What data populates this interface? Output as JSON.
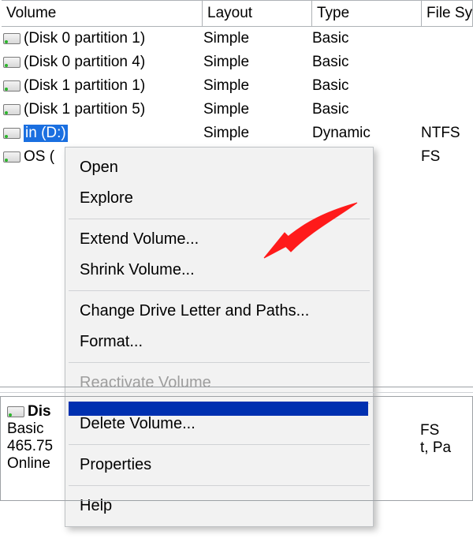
{
  "headers": {
    "volume": "Volume",
    "layout": "Layout",
    "type": "Type",
    "fs": "File Sys"
  },
  "rows": [
    {
      "name": "(Disk 0 partition 1)",
      "layout": "Simple",
      "type": "Basic",
      "fs": ""
    },
    {
      "name": "(Disk 0 partition 4)",
      "layout": "Simple",
      "type": "Basic",
      "fs": ""
    },
    {
      "name": "(Disk 1 partition 1)",
      "layout": "Simple",
      "type": "Basic",
      "fs": ""
    },
    {
      "name": "(Disk 1 partition 5)",
      "layout": "Simple",
      "type": "Basic",
      "fs": ""
    },
    {
      "name": "in (D:)",
      "layout": "Simple",
      "type": "Dynamic",
      "fs": "NTFS",
      "selected": true
    },
    {
      "name": "OS (",
      "layout": "",
      "type": "",
      "fs": "FS"
    }
  ],
  "menu": [
    {
      "label": "Open"
    },
    {
      "label": "Explore"
    },
    {
      "sep": true
    },
    {
      "label": "Extend Volume..."
    },
    {
      "label": "Shrink Volume..."
    },
    {
      "sep": true
    },
    {
      "label": "Change Drive Letter and Paths..."
    },
    {
      "label": "Format..."
    },
    {
      "sep": true
    },
    {
      "label": "Reactivate Volume",
      "disabled": true
    },
    {
      "sep": true
    },
    {
      "label": "Delete Volume..."
    },
    {
      "sep": true
    },
    {
      "label": "Properties"
    },
    {
      "sep": true
    },
    {
      "label": "Help"
    }
  ],
  "disk": {
    "title": "Dis",
    "type": "Basic",
    "size": "465.75",
    "status": "Online",
    "right_fs": "FS",
    "right_note": "t, Pa"
  }
}
